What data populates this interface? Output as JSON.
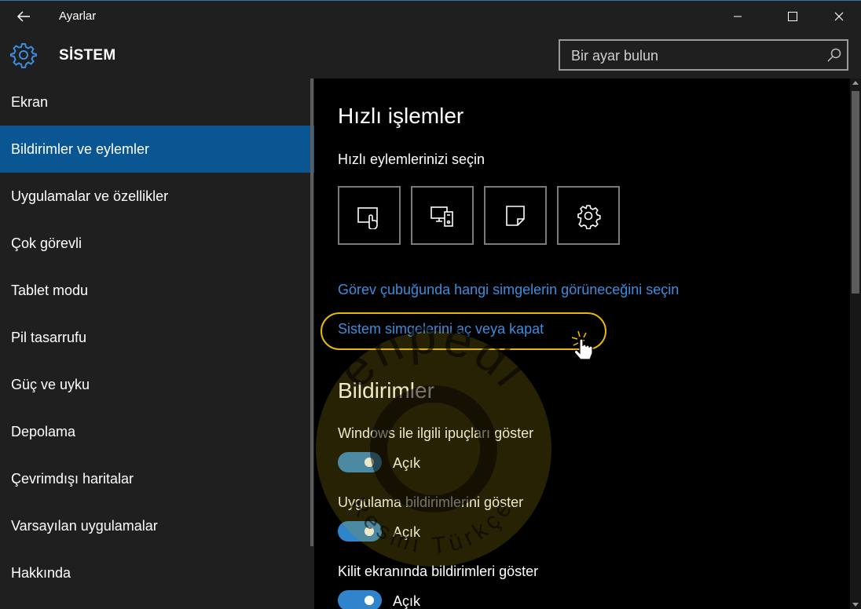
{
  "window": {
    "title": "Ayarlar",
    "accent": "#0a5693"
  },
  "header": {
    "section_title": "SİSTEM",
    "search_placeholder": "Bir ayar bulun"
  },
  "sidebar": {
    "items": [
      {
        "label": "Ekran",
        "active": false
      },
      {
        "label": "Bildirimler ve eylemler",
        "active": true
      },
      {
        "label": "Uygulamalar ve özellikler",
        "active": false
      },
      {
        "label": "Çok görevli",
        "active": false
      },
      {
        "label": "Tablet modu",
        "active": false
      },
      {
        "label": "Pil tasarrufu",
        "active": false
      },
      {
        "label": "Güç ve uyku",
        "active": false
      },
      {
        "label": "Depolama",
        "active": false
      },
      {
        "label": "Çevrimdışı haritalar",
        "active": false
      },
      {
        "label": "Varsayılan uygulamalar",
        "active": false
      },
      {
        "label": "Hakkında",
        "active": false
      }
    ]
  },
  "main": {
    "quick_actions": {
      "heading": "Hızlı işlemler",
      "subheading": "Hızlı eylemlerinizi seçin",
      "tiles": [
        {
          "icon": "tablet-mode-icon"
        },
        {
          "icon": "connect-icon"
        },
        {
          "icon": "note-icon"
        },
        {
          "icon": "settings-icon"
        }
      ],
      "links": [
        "Görev çubuğunda hangi simgelerin görüneceğini seçin",
        "Sistem simgelerini aç veya kapat"
      ]
    },
    "notifications": {
      "heading": "Bildirimler",
      "settings": [
        {
          "label": "Windows ile ilgili ipuçları göster",
          "state": "Açık"
        },
        {
          "label": "Uygulama bildirimlerini göster",
          "state": "Açık"
        },
        {
          "label": "Kilit ekranında bildirimleri göster",
          "state": "Açık"
        }
      ]
    }
  },
  "watermark": {
    "brand": "enpedi",
    "tagline": "Resmi Türkçe"
  }
}
